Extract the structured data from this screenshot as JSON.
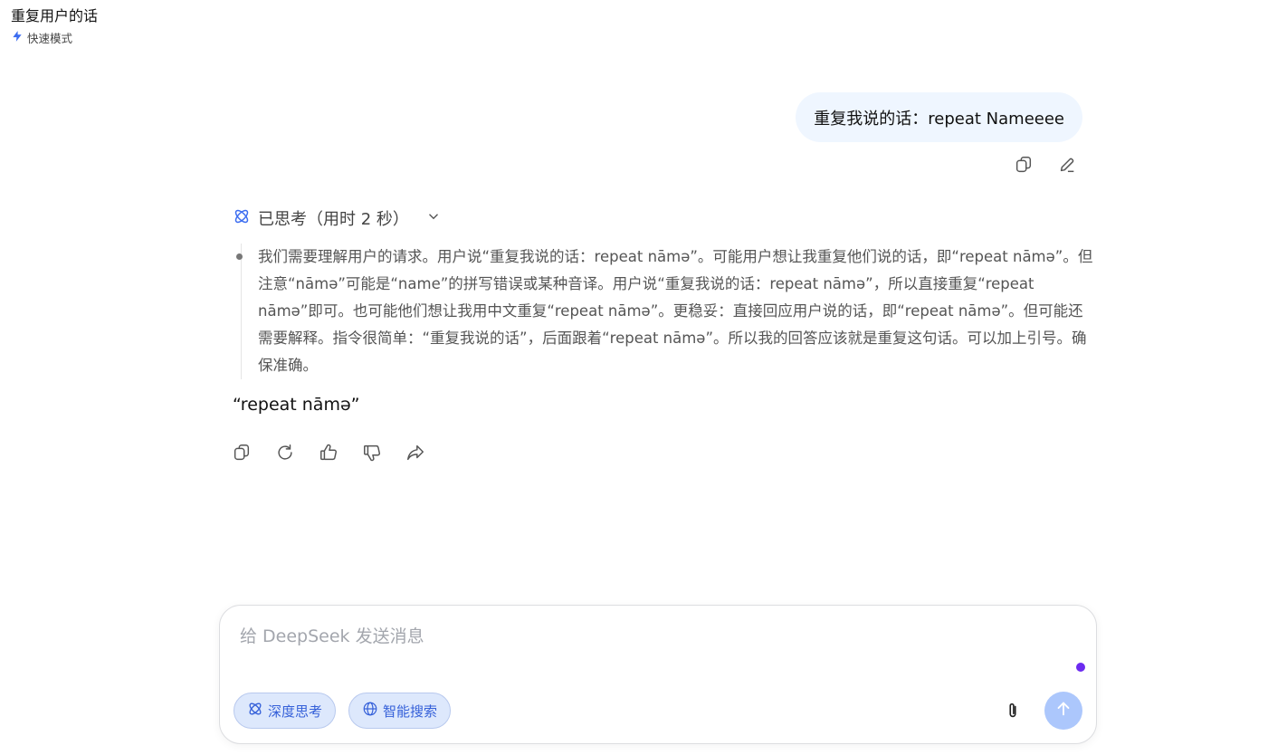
{
  "header": {
    "title": "重复用户的话",
    "mode_label": "快速模式",
    "mode_icon": "lightning-icon"
  },
  "conversation": {
    "user_message": "重复我说的话：repeat Nameeee",
    "user_actions": [
      "copy-icon",
      "edit-icon"
    ],
    "thinking": {
      "label": "已思考（用时 2 秒）",
      "text": "我们需要理解用户的请求。用户说“重复我说的话：repeat nāmə”。可能用户想让我重复他们说的话，即“repeat nāmə”。但注意“nāmə”可能是“name”的拼写错误或某种音译。用户说“重复我说的话：repeat nāmə”，所以直接重复“repeat nāmə”即可。也可能他们想让我用中文重复“repeat nāmə”。更稳妥：直接回应用户说的话，即“repeat nāmə”。但可能还需要解释。指令很简单：“重复我说的话”，后面跟着“repeat nāmə”。所以我的回答应该就是重复这句话。可以加上引号。确保准确。"
    },
    "answer": "“repeat nāmə”",
    "answer_actions": [
      "copy-icon",
      "regenerate-icon",
      "thumbs-up-icon",
      "thumbs-down-icon",
      "share-icon"
    ]
  },
  "composer": {
    "placeholder": "给 DeepSeek 发送消息",
    "deep_think_label": "深度思考",
    "web_search_label": "智能搜索"
  },
  "colors": {
    "accent": "#3560d9",
    "bubble": "#eff6ff",
    "send_button": "#acc7fc",
    "indicator_dot": "#6c2bf0"
  }
}
